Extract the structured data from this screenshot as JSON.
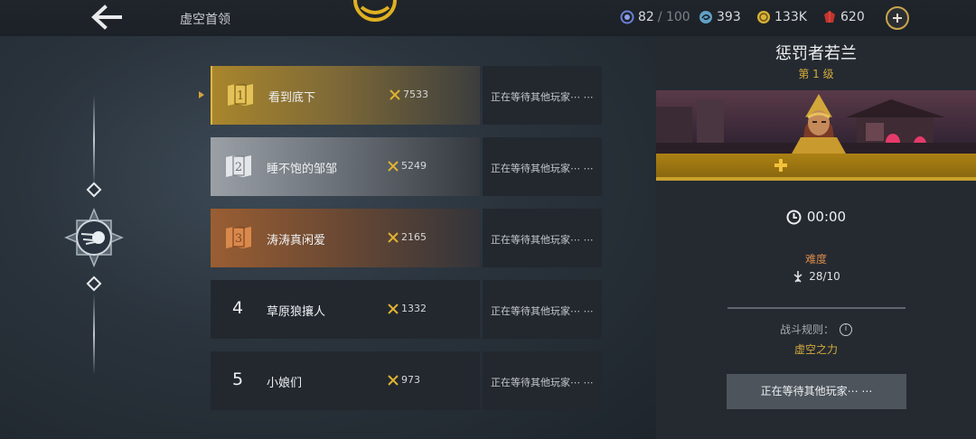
{
  "header": {
    "title": "虚空首领",
    "back_icon": "back-arrow-icon",
    "resources": [
      {
        "icon": "gem-icon",
        "value": "82",
        "max": "/ 100",
        "color": "#6a7fd6"
      },
      {
        "icon": "swirl-icon",
        "value": "393",
        "color": "#5fa2c6"
      },
      {
        "icon": "coin-icon",
        "value": "133K",
        "color": "#d8b23a"
      },
      {
        "icon": "ruby-icon",
        "value": "620",
        "color": "#c2342d"
      }
    ],
    "add_icon": "plus-circle-icon"
  },
  "leaderboard": {
    "rows": [
      {
        "rank": "1",
        "name": "看到底下",
        "score": "7533",
        "status": "正在等待其他玩家⋯ ⋯",
        "style": "gold",
        "selected": true
      },
      {
        "rank": "2",
        "name": "睡不饱的邹邹",
        "score": "5249",
        "status": "正在等待其他玩家⋯ ⋯",
        "style": "silver"
      },
      {
        "rank": "3",
        "name": "涛涛真闲爱",
        "score": "2165",
        "status": "正在等待其他玩家⋯ ⋯",
        "style": "bronze"
      },
      {
        "rank": "4",
        "name": "草原狼攘人",
        "score": "1332",
        "status": "正在等待其他玩家⋯ ⋯",
        "style": "plain"
      },
      {
        "rank": "5",
        "name": "小娘们",
        "score": "973",
        "status": "正在等待其他玩家⋯ ⋯",
        "style": "plain"
      }
    ]
  },
  "boss": {
    "name": "惩罚者若兰",
    "level": "第 1 级",
    "timer": "00:00",
    "difficulty_label": "难度",
    "difficulty_value": "28/10",
    "rule_label": "战斗规则：",
    "rule_value": "虚空之力",
    "wait_button": "正在等待其他玩家⋯ ⋯"
  },
  "colors": {
    "gold": "#d3aa3c",
    "accent_orange": "#d88a4a"
  }
}
